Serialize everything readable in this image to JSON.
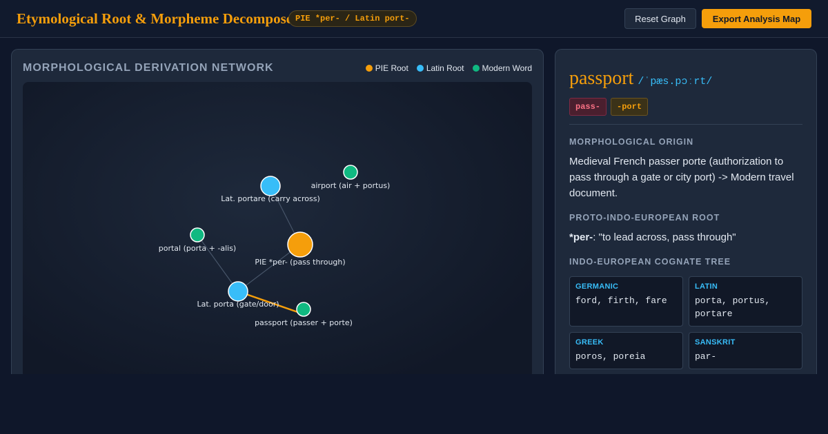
{
  "header": {
    "title": "Etymological Root & Morpheme Decomposer",
    "root_badge": "PIE *per- / Latin port-",
    "reset_label": "Reset Graph",
    "export_label": "Export Analysis Map"
  },
  "graph": {
    "title": "MORPHOLOGICAL DERIVATION NETWORK",
    "legend": [
      {
        "label": "PIE Root",
        "color": "#f59e0b"
      },
      {
        "label": "Latin Root",
        "color": "#38bdf8"
      },
      {
        "label": "Modern Word",
        "color": "#10b981"
      }
    ],
    "nodes": [
      {
        "id": "pie",
        "label": "PIE *per- (pass through)",
        "kind": "pie"
      },
      {
        "id": "portare",
        "label": "Lat. portare (carry across)",
        "kind": "latin"
      },
      {
        "id": "porta",
        "label": "Lat. porta (gate/door)",
        "kind": "latin"
      },
      {
        "id": "airport",
        "label": "airport (air + portus)",
        "kind": "modern"
      },
      {
        "id": "portal",
        "label": "portal (porta + -alis)",
        "kind": "modern"
      },
      {
        "id": "passport",
        "label": "passport (passer + porte)",
        "kind": "modern"
      }
    ],
    "edges": [
      {
        "from": "pie",
        "to": "portare",
        "highlight": false
      },
      {
        "from": "pie",
        "to": "porta",
        "highlight": false
      },
      {
        "from": "porta",
        "to": "portal",
        "highlight": false
      },
      {
        "from": "porta",
        "to": "passport",
        "highlight": true
      }
    ]
  },
  "detail": {
    "word": "passport",
    "ipa": "/ˈpæs.pɔːrt/",
    "prefix": "pass-",
    "suffix": "-port",
    "origin_label": "MORPHOLOGICAL ORIGIN",
    "origin_text": "Medieval French passer porte (authorization to pass through a gate or city port) -> Modern travel document.",
    "pie_label": "PROTO-INDO-EUROPEAN ROOT",
    "pie_root": "*per-",
    "pie_gloss": ": \"to lead across, pass through\"",
    "cognate_label": "INDO-EUROPEAN COGNATE TREE",
    "cognates": [
      {
        "lang": "GERMANIC",
        "words": "ford, firth, fare"
      },
      {
        "lang": "LATIN",
        "words": "porta, portus, portare"
      },
      {
        "lang": "GREEK",
        "words": "poros, poreia"
      },
      {
        "lang": "SANSKRIT",
        "words": "par-"
      }
    ]
  },
  "colors": {
    "accent": "#f59e0b",
    "latin": "#38bdf8",
    "modern": "#10b981",
    "background": "#0f172a"
  }
}
